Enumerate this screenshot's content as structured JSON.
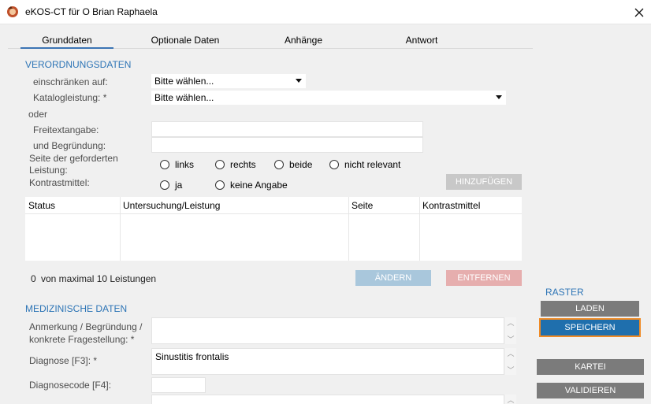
{
  "window": {
    "title": "eKOS-CT für O Brian Raphaela",
    "app_icon": "ekos-app-icon",
    "close_icon": "close-icon"
  },
  "tabs": [
    {
      "label": "Grunddaten",
      "active": true
    },
    {
      "label": "Optionale Daten",
      "active": false
    },
    {
      "label": "Anhänge",
      "active": false
    },
    {
      "label": "Antwort",
      "active": false
    }
  ],
  "verordnung": {
    "section_title": "VERORDNUNGSDATEN",
    "einschraenken_label": "einschränken auf:",
    "einschraenken_value": "Bitte wählen...",
    "katalog_label": "Katalogleistung: *",
    "katalog_value": "Bitte wählen...",
    "oder_label": "oder",
    "freitext_label": "Freitextangabe:",
    "freitext_value": "",
    "begruendung_label": "und Begründung:",
    "begruendung_value": "",
    "seite_label": "Seite der geforderten Leistung:",
    "seite_options": [
      "links",
      "rechts",
      "beide",
      "nicht relevant"
    ],
    "kontrast_label": "Kontrastmittel:",
    "kontrast_options": [
      "ja",
      "keine Angabe"
    ],
    "add_button": "HINZUFÜGEN"
  },
  "table": {
    "columns": [
      "Status",
      "Untersuchung/Leistung",
      "Seite",
      "Kontrastmittel"
    ],
    "rows": []
  },
  "summary": {
    "count": "0",
    "count_text": "von maximal 10 Leistungen",
    "change_button": "ÄNDERN",
    "remove_button": "ENTFERNEN"
  },
  "medizinisch": {
    "section_title": "MEDIZINISCHE DATEN",
    "anmerkung_label": "Anmerkung / Begründung /\nkonkrete Fragestellung: *",
    "anmerkung_value": "",
    "diagnose_label": "Diagnose [F3]: *",
    "diagnose_value": "Sinustitis frontalis",
    "diagnosecode_label": "Diagnosecode [F4]:",
    "diagnosecode_value": ""
  },
  "raster": {
    "label": "RASTER",
    "load_button": "LADEN",
    "save_button": "SPEICHERN"
  },
  "actions": {
    "kartei_button": "KARTEI",
    "validieren_button": "VALIDIEREN"
  },
  "colors": {
    "accent": "#2e75b6",
    "primary_button": "#1f6fad",
    "focus_outline": "#f08a24"
  }
}
